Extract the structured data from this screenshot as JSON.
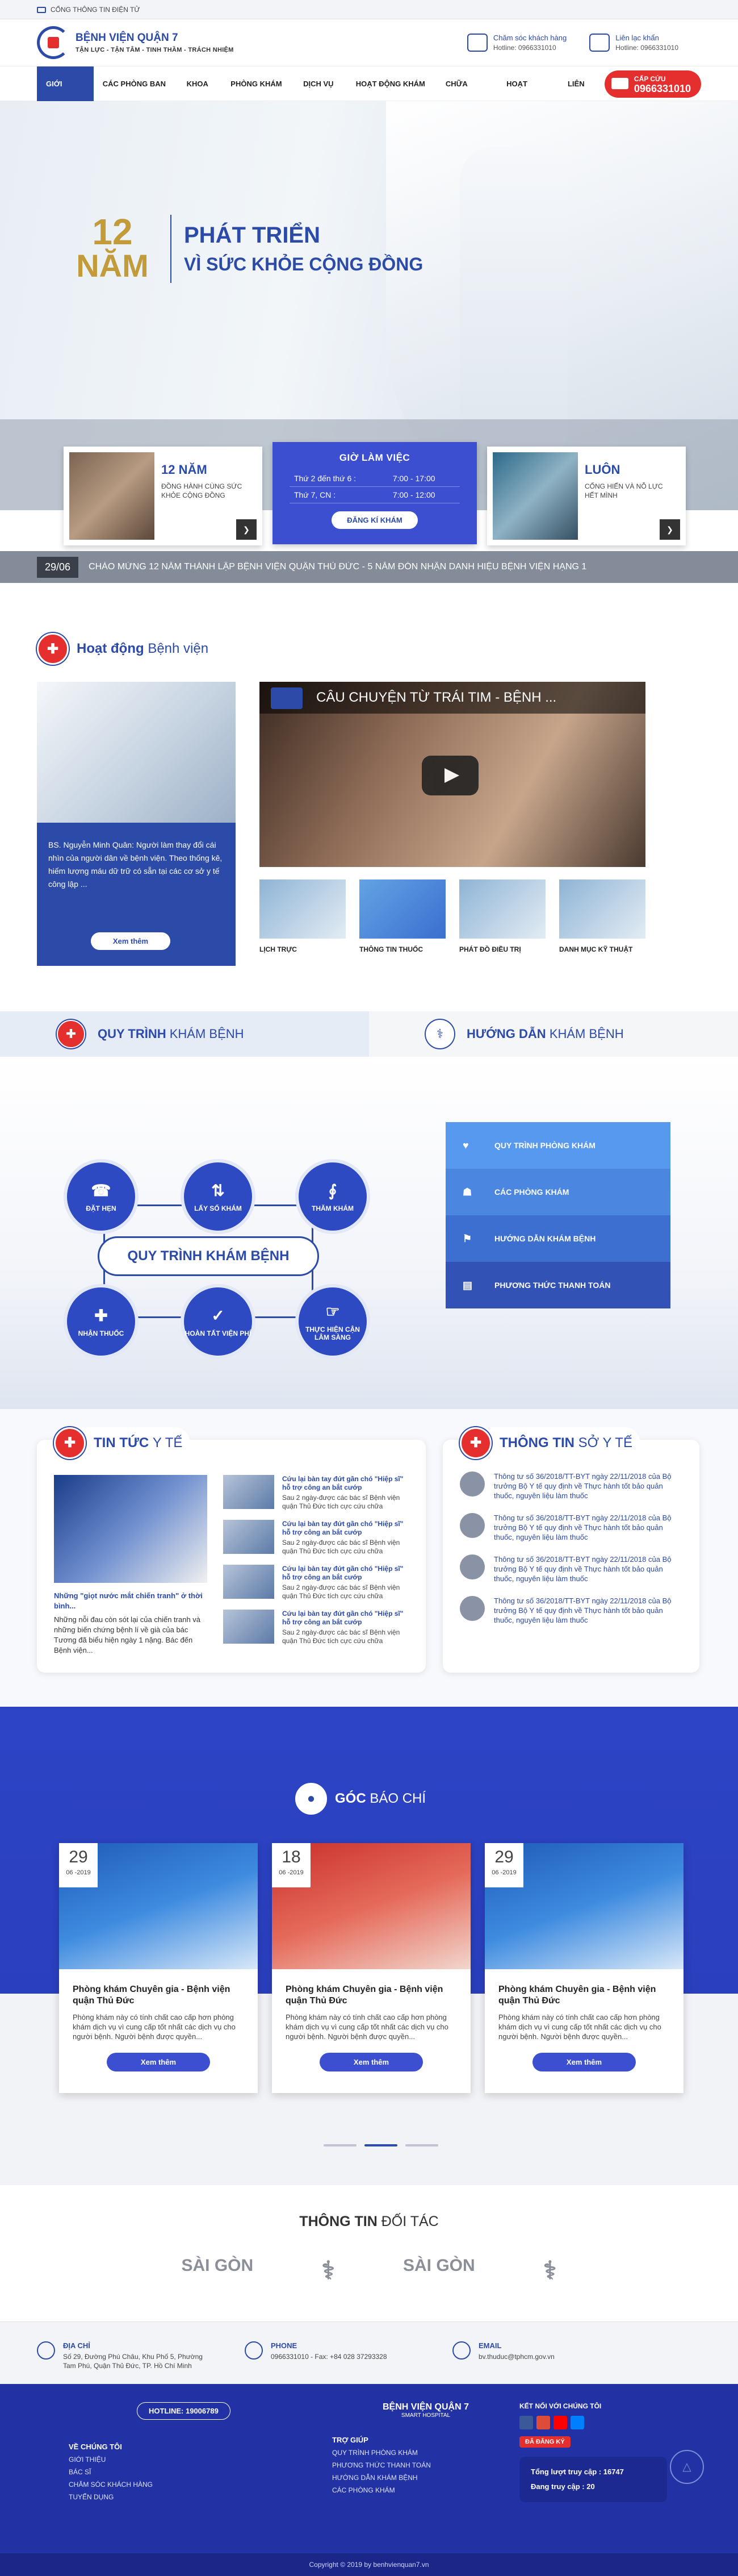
{
  "topbar": {
    "label": "CỔNG THÔNG TIN ĐIỆN TỬ",
    "social": [
      "f",
      "t",
      "G"
    ]
  },
  "header": {
    "title": "BỆNH VIỆN QUẬN 7",
    "motto": "TẬN LỰC - TẬN TÂM - TINH THẦM - TRÁCH NHIỆM",
    "care_label": "Chăm sóc khách hàng",
    "care_value": "Hotline: 0966331010",
    "contact_label": "Liên lạc khẩn",
    "contact_value": "Hotline: 0966331010"
  },
  "nav": {
    "items": [
      "GIỚI THIỆU",
      "CÁC PHÒNG BAN ▾",
      "KHOA ▾",
      "PHÒNG KHÁM ▾",
      "DỊCH VỤ ▾",
      "HOẠT ĐỘNG KHÁM ▾",
      "CHỮA BỆNH",
      "HOẠT ĐỘNG",
      "LIÊN HỆ"
    ],
    "emergency_label": "CẤP CỨU",
    "emergency_phone": "0966331010"
  },
  "hero": {
    "years_num": "12",
    "years_word": "NĂM",
    "slogan1": "PHÁT TRIỂN",
    "slogan2": "VÌ SỨC KHỎE CỘNG ĐỒNG"
  },
  "features": {
    "f1_title": "12 NĂM",
    "f1_text": "ĐỒNG HÀNH CÙNG SỨC KHỎE CỘNG ĐỒNG",
    "f2_title": "GIỜ LÀM VIỆC",
    "f2_row1_day": "Thứ 2  đến thứ 6 :",
    "f2_row1_time": "7:00 - 17:00",
    "f2_row2_day": "Thứ 7, CN :",
    "f2_row2_time": "7:00 - 12:00",
    "f2_button": "ĐĂNG KÍ KHÁM",
    "f3_title": "LUÔN",
    "f3_text": "CỐNG HIẾN VÀ NỖ LỰC HẾT MÌNH"
  },
  "ticker": {
    "date": "29/06",
    "message": "CHÀO MỪNG 12 NĂM THÀNH LẬP BỆNH VIỆN QUẬN THỦ ĐỨC - 5 NĂM ĐÓN NHẬN DANH HIỆU BỆNH VIỆN HẠNG 1"
  },
  "activity": {
    "title_bold": "Hoạt động",
    "title_light": "Bệnh viện",
    "doctor_text": "BS. Nguyễn Minh Quân: Người làm thay đổi cái nhìn của người dân về bệnh viện. Theo thống kê, hiếm lượng máu dữ trữ có sẵn tại các cơ sở y tế công lập ...",
    "doctor_button": "Xem thêm",
    "video_title": "CÂU CHUYỆN TỪ TRÁI TIM - BỆNH ...",
    "thumbs": [
      "LỊCH TRỰC",
      "THÔNG TIN THUỐC",
      "PHÁT ĐỒ ĐIỀU TRỊ",
      "DANH MỤC KỸ THUẬT"
    ]
  },
  "process": {
    "tab1_bold": "QUY TRÌNH",
    "tab1_light": "KHÁM BỆNH",
    "tab2_bold": "HƯỚNG DẪN",
    "tab2_light": "KHÁM BỆNH",
    "center": "QUY TRÌNH KHÁM BỆNH",
    "steps": [
      "ĐẶT HẸN",
      "LẤY SỐ KHÁM",
      "THĂM KHÁM",
      "NHẬN THUỐC",
      "HOÀN TẤT VIỆN PHÍ",
      "THỰC HIỆN CẬN LÂM SÀNG"
    ],
    "menu": [
      "QUY TRÌNH PHÒNG KHÁM",
      "CÁC PHÒNG KHÁM",
      "HƯỚNG DẪN KHÁM BỆNH",
      "PHƯƠNG THỨC THANH TOÁN"
    ]
  },
  "news": {
    "title_bold": "TIN TỨC",
    "title_light": "Y TẾ",
    "main_title": "Những \"giọt nước mắt chiến tranh\" ở thời bình...",
    "main_text": "Những nỗi đau còn sót lại của chiến tranh và những biến chứng bệnh lí về già của bác Tương đã biểu hiện ngày 1 nặng. Bác đến Bệnh viện...",
    "items": [
      {
        "title": "Cứu lại bàn tay đứt gần chó \"Hiệp sĩ\" hỗ trợ công an bắt cướp",
        "text": "Sau 2 ngày-được các bác sĩ Bệnh viện quận Thủ Đức tích cực cứu chữa"
      },
      {
        "title": "Cứu lại bàn tay đứt gần chó \"Hiệp sĩ\" hỗ trợ công an bắt cướp",
        "text": "Sau 2 ngày-được các bác sĩ Bệnh viện quận Thủ Đức tích cực cứu chữa"
      },
      {
        "title": "Cứu lại bàn tay đứt gần chó \"Hiệp sĩ\" hỗ trợ công an bắt cướp",
        "text": "Sau 2 ngày-được các bác sĩ Bệnh viện quận Thủ Đức tích cực cứu chữa"
      },
      {
        "title": "Cứu lại bàn tay đứt gần chó \"Hiệp sĩ\" hỗ trợ công an bắt cướp",
        "text": "Sau 2 ngày-được các bác sĩ Bệnh viện quận Thủ Đức tích cực cứu chữa"
      }
    ],
    "health_title_bold": "THÔNG TIN",
    "health_title_light": "SỞ Y TẾ",
    "health_items": [
      "Thông tư số 36/2018/TT-BYT ngày 22/11/2018 của Bộ trưởng Bộ Y tế quy định về Thực hành tốt bảo quản thuốc, nguyên liệu làm thuốc",
      "Thông tư số 36/2018/TT-BYT ngày 22/11/2018 của Bộ trưởng Bộ Y tế quy định về Thực hành tốt bảo quản thuốc, nguyên liệu làm thuốc",
      "Thông tư số 36/2018/TT-BYT ngày 22/11/2018 của Bộ trưởng Bộ Y tế quy định về Thực hành tốt bảo quản thuốc, nguyên liệu làm thuốc",
      "Thông tư số 36/2018/TT-BYT ngày 22/11/2018 của Bộ trưởng Bộ Y tế quy định về Thực hành tốt bảo quản thuốc, nguyên liệu làm thuốc"
    ]
  },
  "press": {
    "title_bold": "GÓC",
    "title_light": "BÁO CHÍ",
    "cards": [
      {
        "day": "29",
        "month": "06 -2019",
        "title": "Phòng khám Chuyên gia - Bệnh viện quận Thủ Đức",
        "text": "Phòng khám này có tính chất cao cấp hơn phòng khám dịch vụ vì cung cấp tốt nhất các dịch vụ cho người bệnh. Người bệnh được quyền...",
        "button": "Xem thêm"
      },
      {
        "day": "18",
        "month": "06 -2019",
        "title": "Phòng khám Chuyên gia - Bệnh viện quận Thủ Đức",
        "text": "Phòng khám này có tính chất cao cấp hơn phòng khám dịch vụ vì cung cấp tốt nhất các dịch vụ cho người bệnh. Người bệnh được quyền...",
        "button": "Xem thêm"
      },
      {
        "day": "29",
        "month": "06 -2019",
        "title": "Phòng khám Chuyên gia - Bệnh viện quận Thủ Đức",
        "text": "Phòng khám này có tính chất cao cấp hơn phòng khám dịch vụ vì cung cấp tốt nhất các dịch vụ cho người bệnh. Người bệnh được quyền...",
        "button": "Xem thêm"
      }
    ]
  },
  "partners": {
    "title_bold": "THÔNG TIN",
    "title_light": "ĐỐI TÁC",
    "logos": [
      "SÀI GÒN",
      "⚕",
      "SÀI GÒN",
      "⚕"
    ]
  },
  "address": {
    "addr_label": "ĐỊA CHỈ",
    "addr_value": "Số 29, Đường Phú Châu, Khu Phố 5, Phường Tam Phú, Quận Thủ Đức, TP. Hồ Chí Minh",
    "phone_label": "PHONE",
    "phone_value": "0966331010 - Fax: +84 028 37293328",
    "email_label": "EMAIL",
    "email_value": "bv.thuduc@tphcm.gov.vn"
  },
  "footer": {
    "hotline": "HOTLINE: 19006789",
    "logo_title": "BỆNH VIỆN QUẬN 7",
    "logo_sub": "SMART HOSPITAL",
    "connect": "KẾT NỐI VỚI CHÚNG TÔI",
    "about_title": "VỀ CHÚNG TÔI",
    "about_links": [
      "GIỚI THIỆU",
      "BÁC SĨ",
      "CHĂM SÓC KHÁCH HÀNG",
      "TUYỂN DỤNG"
    ],
    "help_title": "TRỢ GIÚP",
    "help_links": [
      "QUY TRÌNH PHÒNG KHÁM",
      "PHƯƠNG THỨC THANH TOÁN",
      "HƯỚNG DẪN KHÁM BỆNH",
      "CÁC PHÒNG KHÁM"
    ],
    "registered": "ĐÃ ĐĂNG KÝ",
    "visits_label": "Tổng lượt truy cập :",
    "visits_value": "16747",
    "online_label": "Đang truy cập :",
    "online_value": "20",
    "copyright": "Copyright © 2019 by benhvienquan7.vn"
  }
}
